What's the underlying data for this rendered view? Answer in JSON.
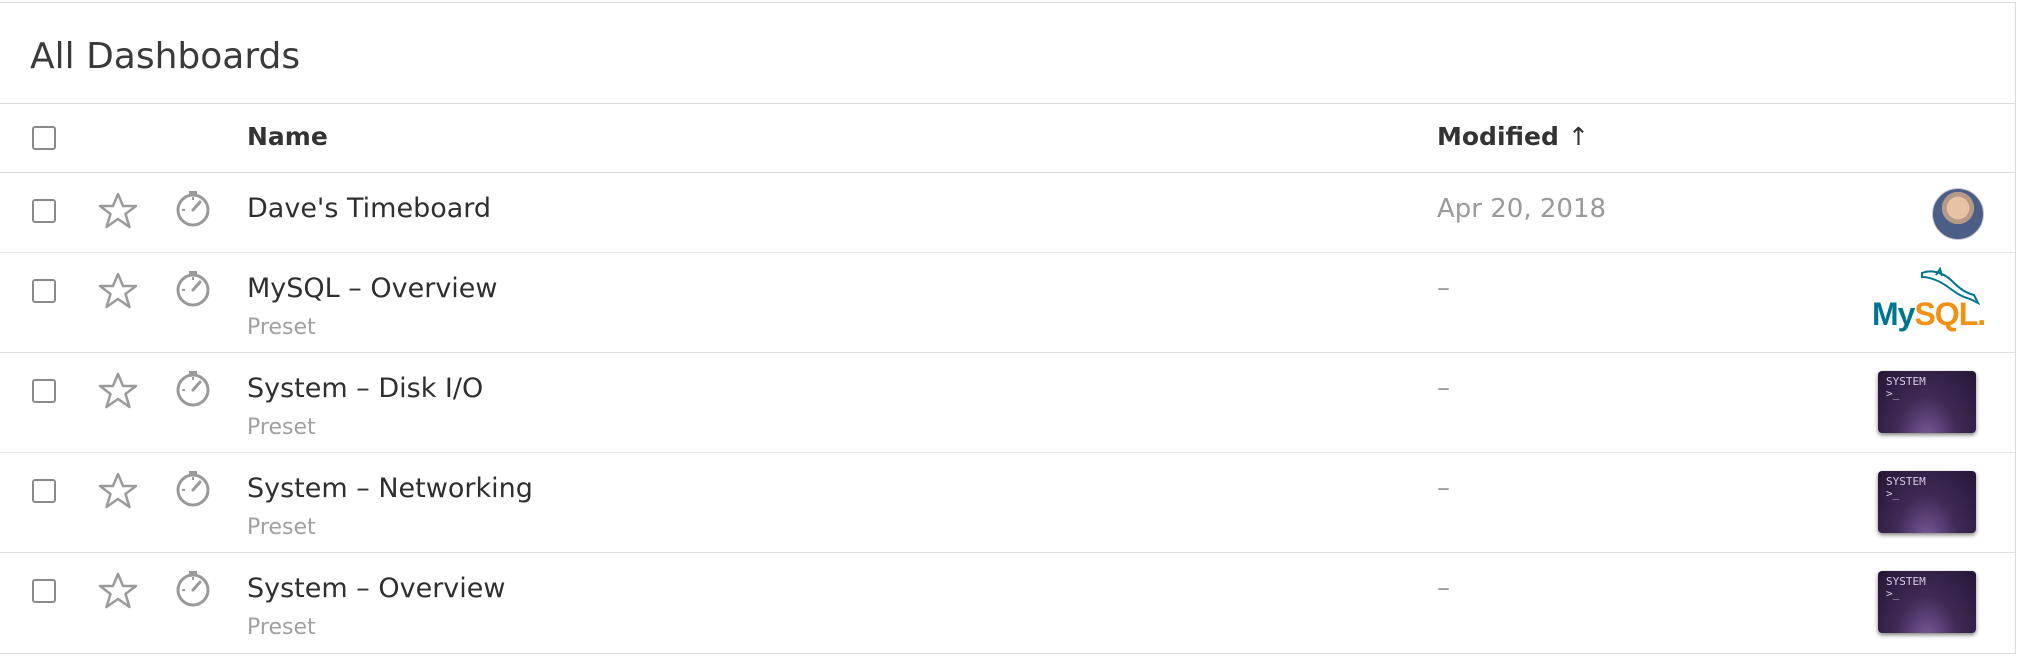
{
  "page": {
    "title": "All Dashboards"
  },
  "table": {
    "headers": {
      "name": "Name",
      "modified": "Modified",
      "sort_indicator": "↑"
    },
    "rows": [
      {
        "name": "Dave's Timeboard",
        "subtitle": "",
        "modified": "Apr 20, 2018",
        "thumbnail": "user-avatar",
        "starred": false
      },
      {
        "name": "MySQL – Overview",
        "subtitle": "Preset",
        "modified": "–",
        "thumbnail": "mysql-logo",
        "starred": false
      },
      {
        "name": "System – Disk I/O",
        "subtitle": "Preset",
        "modified": "–",
        "thumbnail": "system-terminal",
        "starred": false
      },
      {
        "name": "System – Networking",
        "subtitle": "Preset",
        "modified": "–",
        "thumbnail": "system-terminal",
        "starred": false
      },
      {
        "name": "System – Overview",
        "subtitle": "Preset",
        "modified": "–",
        "thumbnail": "system-terminal",
        "starred": false
      }
    ]
  },
  "logos": {
    "mysql": {
      "my": "My",
      "sql": "SQL",
      "dot": "."
    },
    "system": {
      "label": "SYSTEM",
      "prompt": ">_"
    }
  },
  "colors": {
    "mysql_blue": "#00758f",
    "mysql_orange": "#f29111",
    "terminal": "#3f2a55",
    "icon_gray": "#9a9a9a"
  }
}
